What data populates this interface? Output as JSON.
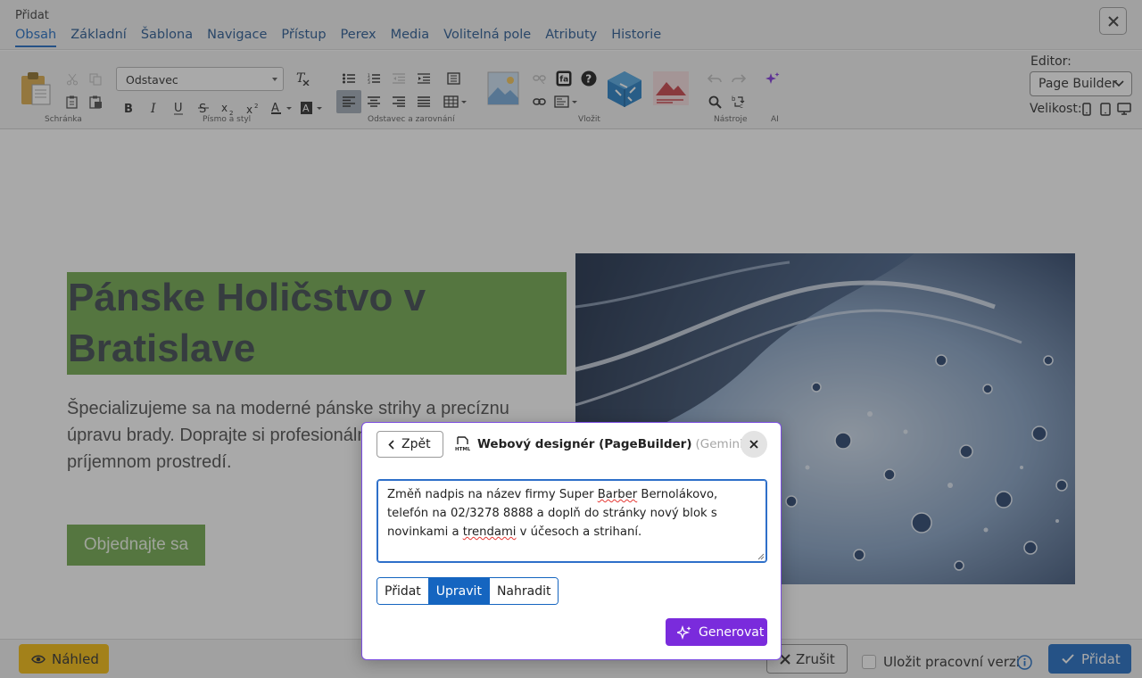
{
  "header": {
    "title": "Přidat",
    "tabs": [
      {
        "label": "Obsah",
        "active": true
      },
      {
        "label": "Základní"
      },
      {
        "label": "Šablona"
      },
      {
        "label": "Navigace"
      },
      {
        "label": "Přístup"
      },
      {
        "label": "Perex"
      },
      {
        "label": "Media"
      },
      {
        "label": "Volitelná pole"
      },
      {
        "label": "Atributy"
      },
      {
        "label": "Historie"
      }
    ]
  },
  "toolbar": {
    "format_select": "Odstavec",
    "groups": {
      "clipboard": "Schránka",
      "font": "Písmo a styl",
      "paragraph": "Odstavec a zarovnání",
      "insert": "Vložit",
      "tools": "Nástroje",
      "ai": "AI"
    },
    "editor_label": "Editor:",
    "editor_value": "Page Builder",
    "size_label": "Velikost:"
  },
  "page": {
    "hero_title": "Pánske Holičstvo v Bratislave",
    "hero_text": "Špecializujeme sa na moderné pánske strihy a precíznu úpravu brady. Doprajte si profesionálnu starostlivosť v príjemnom prostredí.",
    "hero_button": "Objednajte sa"
  },
  "footer": {
    "preview": "Náhled",
    "cancel": "Zrušit",
    "draft": "Uložit pracovní verzi",
    "add": "Přidat"
  },
  "dialog": {
    "back": "Zpět",
    "title": "Webový designér (PageBuilder)",
    "provider": "(Gemini)",
    "prompt_parts": {
      "a": "Změň nadpis na název firmy Super ",
      "b": "Barber",
      "c": " Bernolákovo, telefón na 02/3278 8888 a doplň do stránky nový blok s novinkami a ",
      "d": "trendami",
      "e": " v účesoch a strihaní."
    },
    "modes": [
      {
        "label": "Přidat"
      },
      {
        "label": "Upravit",
        "active": true
      },
      {
        "label": "Nahradit"
      }
    ],
    "generate": "Generovat"
  },
  "colors": {
    "accent": "#1565c0",
    "hero_green": "#6aa444",
    "preview_yellow": "#f5b800",
    "generate_purple": "#7a2bdc"
  }
}
